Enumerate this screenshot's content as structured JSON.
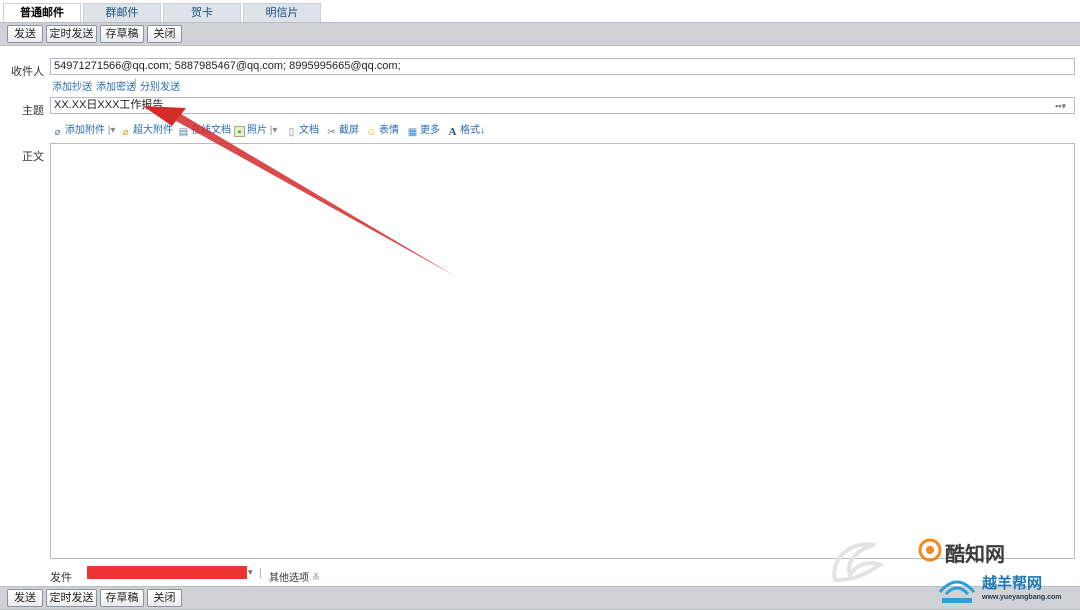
{
  "tabs": [
    {
      "label": "普通邮件",
      "active": true
    },
    {
      "label": "群邮件",
      "active": false
    },
    {
      "label": "贺卡",
      "active": false
    },
    {
      "label": "明信片",
      "active": false
    }
  ],
  "toolbar": {
    "send": "发送",
    "scheduled_send": "定时发送",
    "save_draft": "存草稿",
    "close": "关闭"
  },
  "compose": {
    "to_label": "收件人",
    "to_value": "54971271566@qq.com;  5887985467@qq.com;  8995995665@qq.com;",
    "add_cc": "添加抄送",
    "cc_dash": "-",
    "add_bcc": "添加密送",
    "bcc_sep": "|",
    "separate_send": "分别发送",
    "subject_label": "主题",
    "subject_value": "XX.XX日XXX工作报告",
    "body_label": "正文"
  },
  "format_toolbar": {
    "add_attachment": "添加附件",
    "large_attachment": "超大附件",
    "online_doc": "在线文档",
    "photo": "照片",
    "document": "文档",
    "screenshot": "截屏",
    "emoji": "表情",
    "more": "更多",
    "format": "格式"
  },
  "sender": {
    "label": "发件人：",
    "other_options": "其他选项"
  },
  "watermark": {
    "brand1": "酷知网",
    "brand2": "越羊帮网",
    "brand2_url": "www.yueyangbang.com"
  },
  "colors": {
    "toolbar_bg": "#cfd3d7",
    "link": "#2a6bb5",
    "annotation_arrow": "#d42a2a",
    "redaction": "#ee3333"
  }
}
